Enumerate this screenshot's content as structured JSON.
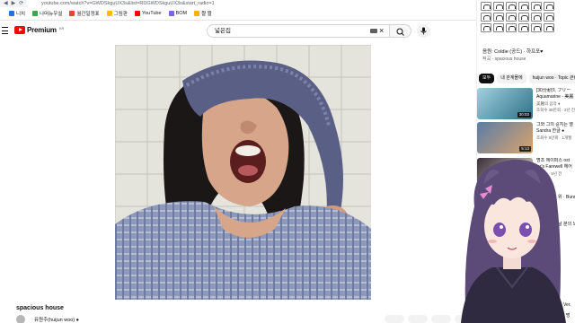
{
  "browser": {
    "url": "youtube.com/watch?v=GWDSkguUX3s&list=RDGWDSkguUX3s&start_radio=1",
    "bookmarks": [
      {
        "label": "니치",
        "color": "#1a73e8"
      },
      {
        "label": "나머뉴우설",
        "color": "#34a853"
      },
      {
        "label": "월간일정표",
        "color": "#ea4335"
      },
      {
        "label": "그림판",
        "color": "#fbbc04"
      },
      {
        "label": "YouTube",
        "color": "#ff0000"
      },
      {
        "label": "BOM",
        "color": "#7b61ff"
      },
      {
        "label": "짤 짤",
        "color": "#f4b400"
      }
    ]
  },
  "header": {
    "logo": "Premium",
    "logo_region": "KR",
    "search_value": "넓은집"
  },
  "video": {
    "title": "spacious house",
    "channel": "유원주(huijun woo) ●",
    "actions": [
      "",
      "",
      "",
      ""
    ]
  },
  "sidebar": {
    "music_line1": "음원: Coldie (공드) · 하프포♥",
    "music_line2": "작곡 · spacious house",
    "chips": [
      {
        "label": "모두",
        "active": true
      },
      {
        "label": "내 관계몰에",
        "active": false
      },
      {
        "label": "huijun woo · Topic 관련",
        "active": false
      }
    ],
    "recommendations": [
      {
        "title": "[30分耐久 フリー",
        "sub": "Aquamarine - 美麗",
        "channel": "美麗의 음악 ●",
        "stats": "조회수 38만회 · 2년 전",
        "duration": "30:03",
        "colors": [
          "#9ed2e0",
          "#2f6f86"
        ]
      },
      {
        "title": "그와 그의 길지는 열",
        "sub": "Sandra 한글 ●",
        "channel": "",
        "stats": "조회수 9만회 · 1개월",
        "duration": "5:13",
        "colors": [
          "#5b7ca6",
          "#d9a36b"
        ]
      },
      {
        "title": "명조 에이퍼스 ost",
        "sub": "jar's Farewell 헤어",
        "channel": "",
        "stats": "조회수 · 5년 전",
        "duration": "",
        "colors": [
          "#3a2e3a",
          "#e8e0d0"
        ]
      }
    ],
    "more_texts": [
      "위 · Bunny C",
      "날 분의 노래",
      "로 Ver.",
      "2천 명"
    ]
  }
}
